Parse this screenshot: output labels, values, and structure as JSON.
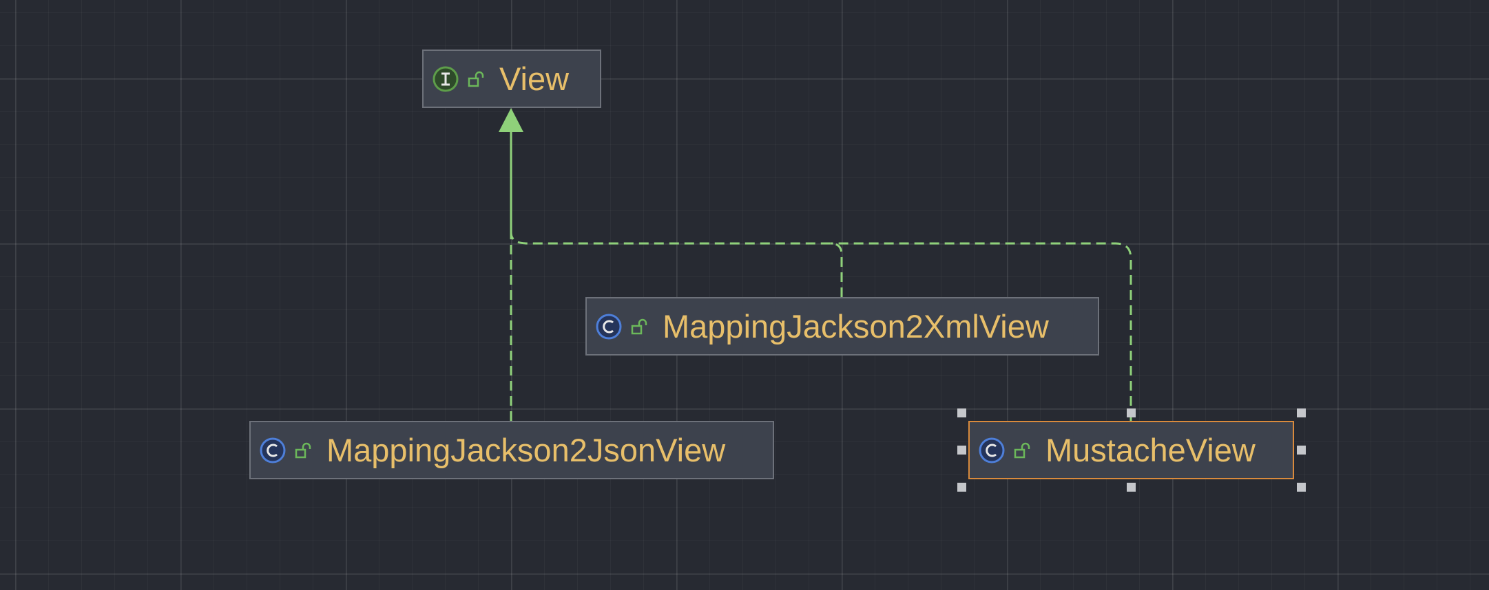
{
  "diagram": {
    "nodes": [
      {
        "id": "view",
        "label": "View",
        "kind": "interface",
        "icon": "interface-icon",
        "visibility_icon": "public-unlock-icon"
      },
      {
        "id": "xml",
        "label": "MappingJackson2XmlView",
        "kind": "class",
        "icon": "class-icon",
        "visibility_icon": "public-unlock-icon"
      },
      {
        "id": "json",
        "label": "MappingJackson2JsonView",
        "kind": "class",
        "icon": "class-icon",
        "visibility_icon": "public-unlock-icon"
      },
      {
        "id": "mustache",
        "label": "MustacheView",
        "kind": "class",
        "icon": "class-icon",
        "visibility_icon": "public-unlock-icon",
        "selected": true
      }
    ],
    "edges": [
      {
        "from": "json",
        "to": "view",
        "type": "implements"
      },
      {
        "from": "xml",
        "to": "view",
        "type": "implements"
      },
      {
        "from": "mustache",
        "to": "view",
        "type": "implements"
      }
    ],
    "colors": {
      "background": "#272a32",
      "node_fill": "#3d424d",
      "node_border": "#6d717a",
      "selected_border": "#d98a3c",
      "label_text": "#e8bf6a",
      "edge": "#8fd17a",
      "interface_icon": "#5e9e4a",
      "class_icon": "#4e7fd9"
    }
  }
}
